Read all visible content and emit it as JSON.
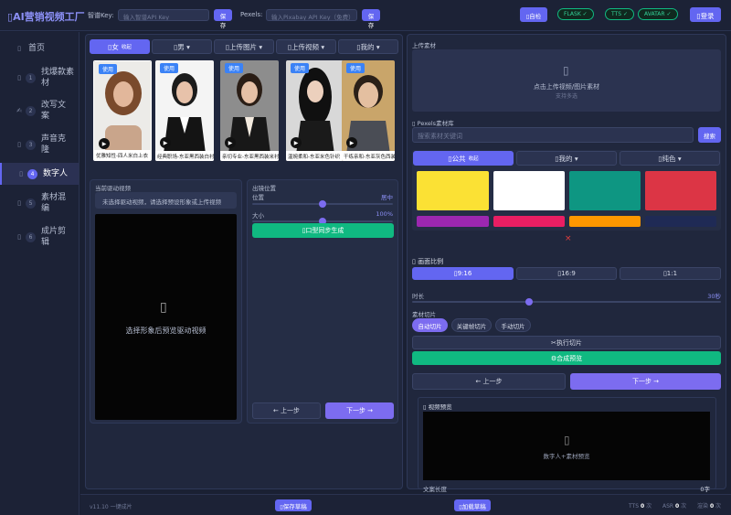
{
  "app": {
    "title": "AI营销视频工厂"
  },
  "top": {
    "key_label": "智谱Key:",
    "key_placeholder": "输入智谱API Key",
    "save1": "保存",
    "pexels_label": "Pexels:",
    "pexels_placeholder": "输入Pixabay API Key（免费）",
    "save2": "保存",
    "selfcheck": "自检",
    "flask": "FLASK ✓",
    "tts": "TTS ✓",
    "avatar": "AVATAR ✓",
    "login": "登录"
  },
  "sidebar": {
    "items": [
      {
        "icon": "home-icon",
        "label": "首页",
        "num": ""
      },
      {
        "icon": "search-icon",
        "label": "找爆款素材",
        "num": "1"
      },
      {
        "icon": "edit-icon",
        "label": "改写文案",
        "num": "2"
      },
      {
        "icon": "mic-icon",
        "label": "声音克隆",
        "num": "3"
      },
      {
        "icon": "person-icon",
        "label": "数字人",
        "num": "4"
      },
      {
        "icon": "film-icon",
        "label": "素材混编",
        "num": "5"
      },
      {
        "icon": "scissors-icon",
        "label": "成片剪辑",
        "num": "6"
      }
    ]
  },
  "avatar": {
    "tabs": [
      {
        "label": "女",
        "sub": "收起"
      },
      {
        "label": "男 ▾"
      },
      {
        "label": "上传图片 ▾"
      },
      {
        "label": "上传视频 ▾"
      },
      {
        "label": "我的 ▾"
      }
    ],
    "use_label": "使用",
    "cards": [
      {
        "caption": "优雅知性-四人米白上衣",
        "color": "#b98a6e"
      },
      {
        "caption": "经典职场-东亚黑西装白衬衫",
        "color": "#f2f2f2"
      },
      {
        "caption": "亲切专业-东亚黑西装米衬衫",
        "color": "#888888"
      },
      {
        "caption": "温婉柔和-东亚米色针织",
        "color": "#cfcfcf"
      },
      {
        "caption": "干练亲和-东亚灰色西装",
        "color": "#c8a66a"
      }
    ]
  },
  "driver": {
    "title": "当前驱动视频",
    "hint": "未选择驱动视频，请选择预设形象或上传视频",
    "placeholder": "选择形象后预览驱动视频"
  },
  "output": {
    "title": "出镜位置",
    "pos_label": "位置",
    "pos_value": "居中",
    "pos": 0.5,
    "size_label": "大小",
    "size_value": "100%",
    "size": 0.5,
    "generate": "口型同步生成",
    "prev": "← 上一步",
    "next": "下一步 →"
  },
  "right": {
    "upload_title": "上传素材",
    "upload_text": "点击上传视频/图片素材",
    "upload_sub": "支持多选",
    "pexels_title": "Pexels素材库",
    "pexels_placeholder": "搜索素材关键词",
    "search_btn": "搜索",
    "lib_tabs": [
      {
        "label": "公共",
        "sub": "收起"
      },
      {
        "label": "我的 ▾"
      },
      {
        "label": "纯色 ▾"
      }
    ],
    "swatches": [
      "#fbe134",
      "#ffffff",
      "#0e9682",
      "#dc3545",
      "#9c27b0",
      "#e91e63",
      "#ff9800",
      "#1f2a55"
    ],
    "close": "×",
    "ratio_title": "画面比例",
    "ratios": [
      "9:16",
      "16:9",
      "1:1"
    ],
    "duration_label": "时长",
    "duration_value": "30秒",
    "duration": 0.38,
    "cut_title": "素材切片",
    "cut_modes": [
      "自动切片",
      "关键帧切片",
      "手动切片"
    ],
    "exec": "执行切片",
    "compose": "合成预览",
    "prev": "← 上一步",
    "next": "下一步 →",
    "preview_title": "视频预览",
    "preview_text": "数字人+素材预览",
    "len_label": "文案长度",
    "len_value": "0字"
  },
  "footer": {
    "version": "v11.10 一键成片",
    "save_draft": "保存草稿",
    "load_draft": "加载草稿",
    "tts_label": "TTS",
    "tts_val": "0",
    "asr_label": "ASR",
    "asr_val": "0",
    "render_label": "渲染",
    "render_val": "0",
    "unit": "次"
  }
}
